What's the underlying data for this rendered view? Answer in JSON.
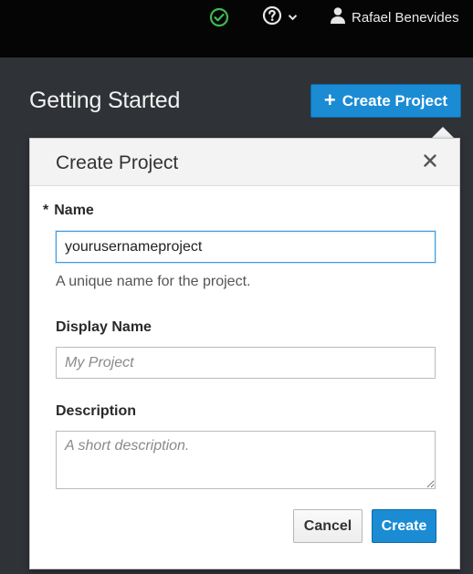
{
  "masthead": {
    "status_icon": "check-circle-icon",
    "status_color": "#3fb950",
    "help_icon": "question-circle-icon",
    "user_icon": "user-icon",
    "user_name": "Rafael Benevides"
  },
  "header": {
    "page_title": "Getting Started",
    "create_project_label": "Create Project"
  },
  "popover": {
    "title": "Create Project",
    "fields": {
      "name": {
        "required_marker": "*",
        "label": "Name",
        "value": "yourusernameproject",
        "help": "A unique name for the project."
      },
      "display_name": {
        "label": "Display Name",
        "value": "",
        "placeholder": "My Project"
      },
      "description": {
        "label": "Description",
        "value": "",
        "placeholder": "A short description."
      }
    },
    "actions": {
      "cancel_label": "Cancel",
      "create_label": "Create"
    }
  },
  "colors": {
    "accent": "#1b8bd4",
    "masthead_bg": "#050505",
    "page_bg": "#2f3237"
  }
}
